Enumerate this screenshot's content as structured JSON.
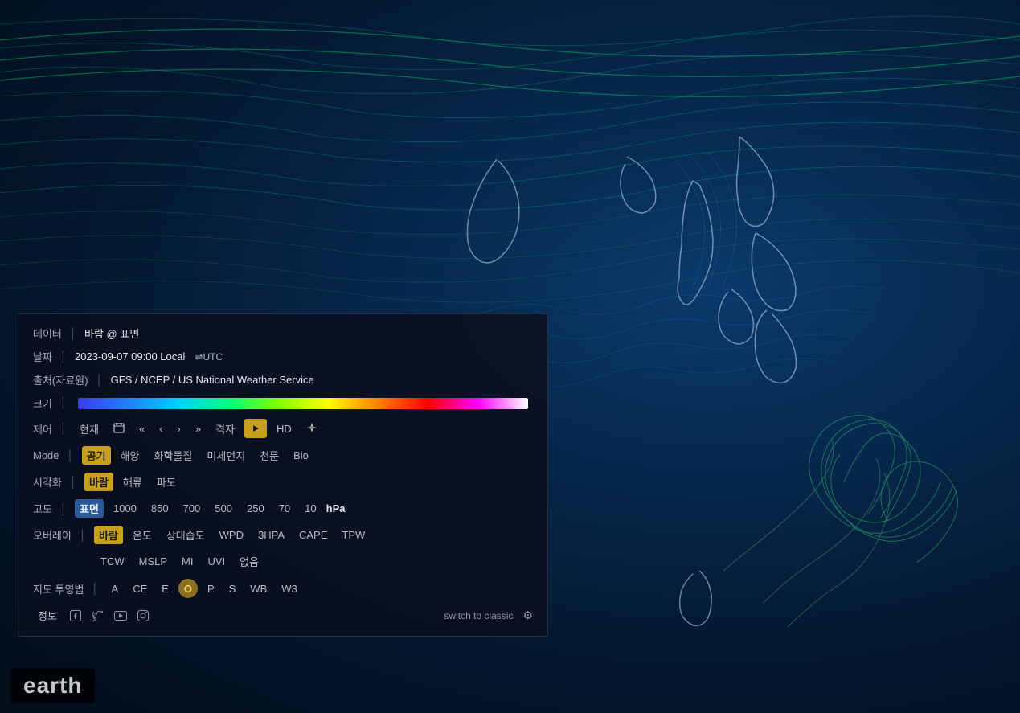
{
  "map": {
    "background_color": "#031525"
  },
  "header": {
    "data_label": "데이터",
    "data_value": "바람 @ 표면",
    "date_label": "날짜",
    "date_value": "2023-09-07 09:00 Local",
    "utc_toggle": "⇌UTC",
    "source_label": "출처(자료원)",
    "source_value": "GFS / NCEP / US National Weather Service",
    "scale_label": "크기"
  },
  "controls": {
    "label": "제어",
    "current_btn": "현재",
    "calendar_icon": "📅",
    "rewind_fast": "«",
    "rewind": "‹",
    "forward": "›",
    "forward_fast": "»",
    "grid_btn": "격자",
    "hd_btn": "HD",
    "compass_icon": "✈"
  },
  "mode": {
    "label": "Mode",
    "items": [
      "공기",
      "해양",
      "화학물질",
      "미세먼지",
      "천문",
      "Bio"
    ],
    "active": "공기"
  },
  "visualization": {
    "label": "시각화",
    "items": [
      "바람",
      "해류",
      "파도"
    ],
    "active": "바람"
  },
  "altitude": {
    "label": "고도",
    "items": [
      "표면",
      "1000",
      "850",
      "700",
      "500",
      "250",
      "70",
      "10"
    ],
    "unit": "hPa",
    "active": "표면"
  },
  "overlay": {
    "label": "오버레이",
    "row1": [
      "바람",
      "온도",
      "상대습도",
      "WPD",
      "3HPA",
      "CAPE",
      "TPW"
    ],
    "row2": [
      "TCW",
      "MSLP",
      "MI",
      "UVI",
      "없음"
    ],
    "active": "바람"
  },
  "projection": {
    "label": "지도 투영법",
    "items": [
      "A",
      "CE",
      "E",
      "O",
      "P",
      "S",
      "WB",
      "W3"
    ],
    "active": "O"
  },
  "footer": {
    "info_btn": "정보",
    "social_items": [
      "facebook",
      "twitter",
      "youtube",
      "instagram"
    ],
    "switch_classic": "switch to classic",
    "settings_icon": "⚙"
  },
  "earth_label": "earth"
}
